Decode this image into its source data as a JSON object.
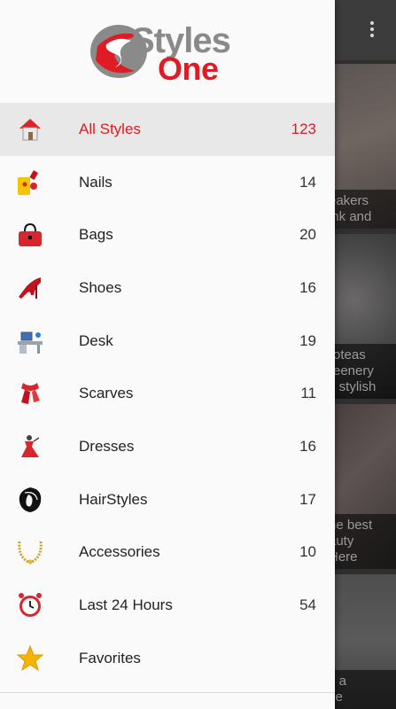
{
  "app": {
    "logo_top": "Styles",
    "logo_bottom": "One",
    "brand_color": "#e01b24"
  },
  "menu": {
    "items": [
      {
        "label": "All Styles",
        "count": "123",
        "icon": "house-icon",
        "active": true
      },
      {
        "label": "Nails",
        "count": "14",
        "icon": "nail-polish-icon"
      },
      {
        "label": "Bags",
        "count": "20",
        "icon": "handbag-icon"
      },
      {
        "label": "Shoes",
        "count": "16",
        "icon": "high-heel-icon"
      },
      {
        "label": "Desk",
        "count": "19",
        "icon": "desk-computer-icon"
      },
      {
        "label": "Scarves",
        "count": "11",
        "icon": "scarf-icon"
      },
      {
        "label": "Dresses",
        "count": "16",
        "icon": "dress-icon"
      },
      {
        "label": "HairStyles",
        "count": "17",
        "icon": "hair-icon"
      },
      {
        "label": "Accessories",
        "count": "10",
        "icon": "necklace-icon"
      },
      {
        "label": "Last 24 Hours",
        "count": "54",
        "icon": "alarm-clock-icon"
      },
      {
        "label": "Favorites",
        "count": "",
        "icon": "star-icon"
      }
    ]
  },
  "background": {
    "cards": [
      {
        "caption": [
          "eakers",
          "ink and"
        ]
      },
      {
        "caption": [
          "roteas",
          "reenery",
          "s stylish"
        ]
      },
      {
        "caption": [
          "he best",
          "auty",
          "Here"
        ]
      },
      {
        "caption": [
          "s a",
          "ce"
        ]
      }
    ]
  }
}
